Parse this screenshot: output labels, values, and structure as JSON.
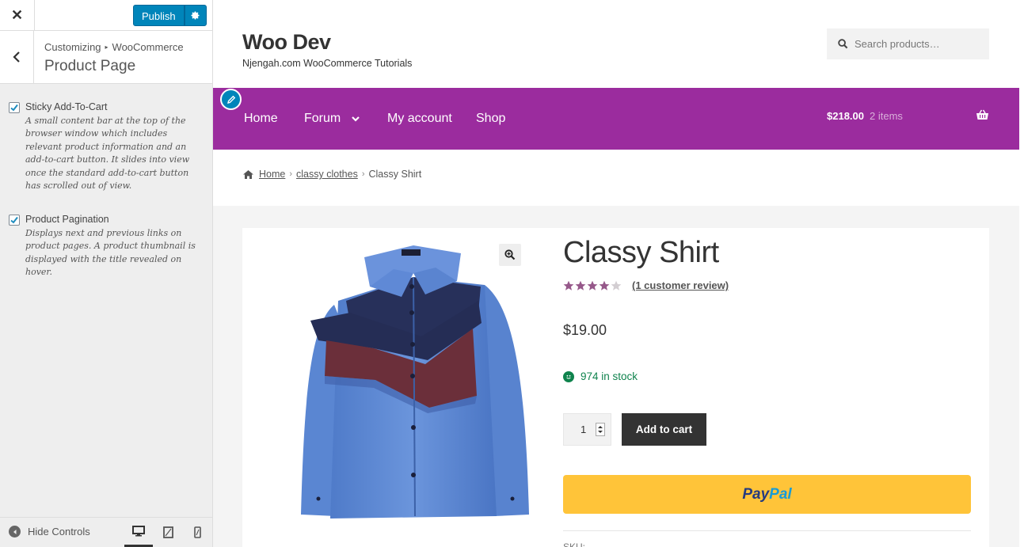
{
  "customizer": {
    "close_label": "✕",
    "publish_label": "Publish",
    "breadcrumb": [
      "Customizing",
      "WooCommerce"
    ],
    "breadcrumb_sep": "▸",
    "section_title": "Product Page",
    "options": [
      {
        "label": "Sticky Add-To-Cart",
        "checked": true,
        "description": "A small content bar at the top of the browser window which includes relevant product information and an add-to-cart button. It slides into view once the standard add-to-cart button has scrolled out of view."
      },
      {
        "label": "Product Pagination",
        "checked": true,
        "description": "Displays next and previous links on product pages. A product thumbnail is displayed with the title revealed on hover."
      }
    ],
    "hide_controls_label": "Hide Controls",
    "devices": [
      "desktop-icon",
      "tablet-icon",
      "mobile-icon"
    ],
    "active_device": "desktop"
  },
  "site": {
    "title": "Woo Dev",
    "description": "Njengah.com WooCommerce Tutorials",
    "search_placeholder": "Search products…",
    "nav_color": "#9b2c9e",
    "nav": [
      "Home",
      "Forum",
      "My account",
      "Shop"
    ],
    "cart_amount": "$218.00",
    "cart_count": "2 items"
  },
  "breadcrumb": {
    "home": "Home",
    "category": "classy clothes",
    "current": "Classy Shirt"
  },
  "product": {
    "title": "Classy Shirt",
    "rating": 4,
    "rating_max": 5,
    "review_link": "(1 customer review)",
    "price": "$19.00",
    "stock": "974 in stock",
    "quantity": "1",
    "add_to_cart_label": "Add to cart",
    "paypal_label_1": "Pay",
    "paypal_label_2": "Pal",
    "sku_label": "SKU:"
  },
  "colors": {
    "publish": "#0085ba",
    "nav": "#9b2c9e",
    "stars": "#96588a",
    "stock": "#0f834d",
    "paypal": "#ffc439"
  }
}
